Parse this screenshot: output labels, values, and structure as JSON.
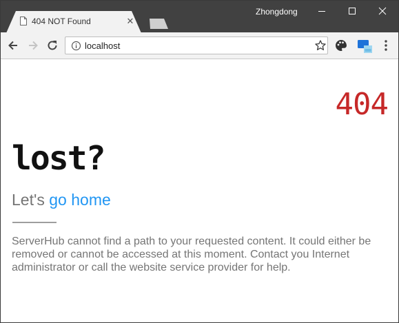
{
  "window": {
    "tab_title": "404 NOT Found",
    "profile_name": "Zhongdong"
  },
  "toolbar": {
    "url": "localhost"
  },
  "page": {
    "status_code": "404",
    "headline": "lost?",
    "prompt_prefix": "Let's ",
    "home_link": "go home",
    "message": "ServerHub cannot find a path to your requested content. It could either be removed or cannot be accessed at this moment. Contact you Internet administrator or call the website service provider for help."
  },
  "colors": {
    "titlebar": "#414141",
    "status_code": "#c62828",
    "link": "#2196f3",
    "muted_text": "#757575"
  }
}
